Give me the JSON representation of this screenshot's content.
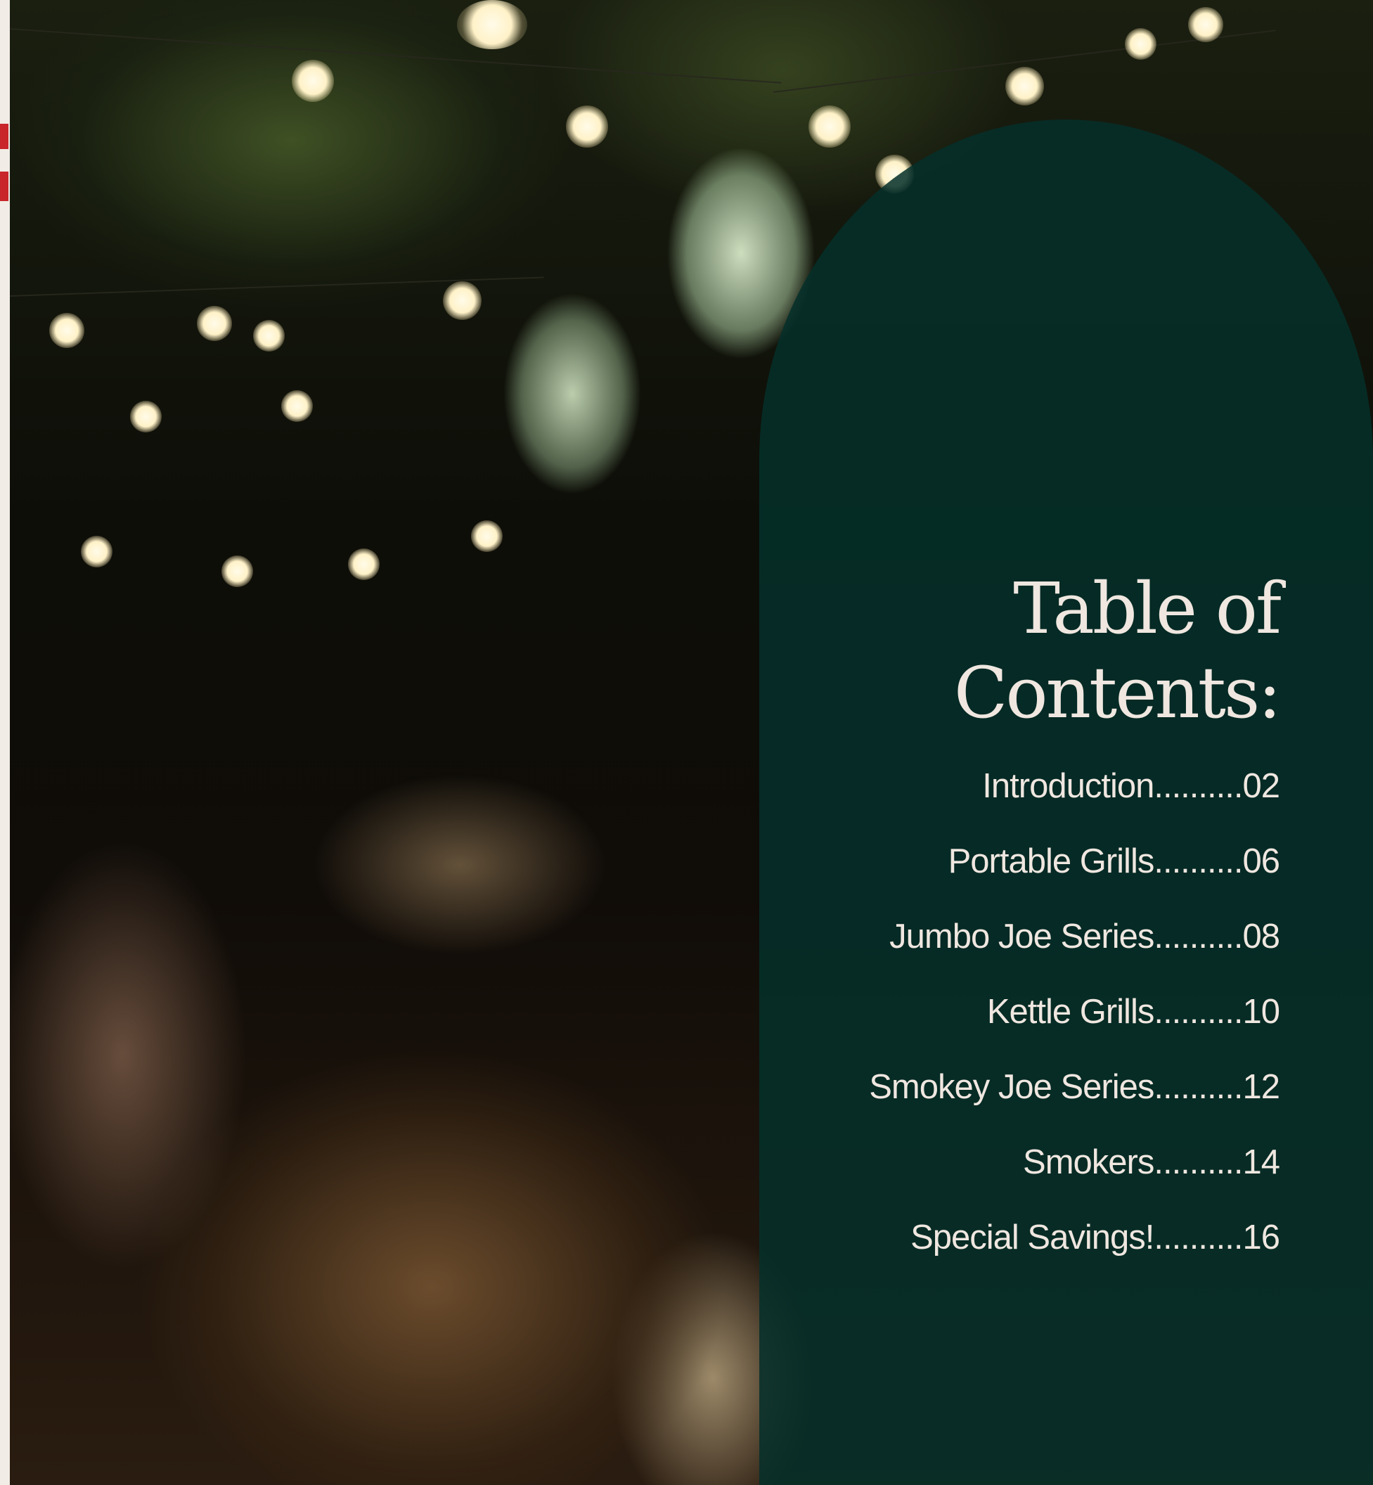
{
  "title": {
    "line1": "Table of",
    "line2": "Contents:"
  },
  "toc": [
    {
      "label": "Introduction",
      "leader": "..........",
      "page": "02"
    },
    {
      "label": "Portable Grills",
      "leader": "..........",
      "page": "06"
    },
    {
      "label": "Jumbo Joe Series",
      "leader": "..........",
      "page": "08"
    },
    {
      "label": "Kettle Grills",
      "leader": "..........",
      "page": "10"
    },
    {
      "label": "Smokey Joe Series",
      "leader": "..........",
      "page": "12"
    },
    {
      "label": "Smokers",
      "leader": "..........",
      "page": "14"
    },
    {
      "label": "Special Savings!",
      "leader": "..........",
      "page": "16"
    }
  ],
  "colors": {
    "panel": "#05302a",
    "text": "#efe7e0",
    "edge_accent": "#c8262b"
  }
}
